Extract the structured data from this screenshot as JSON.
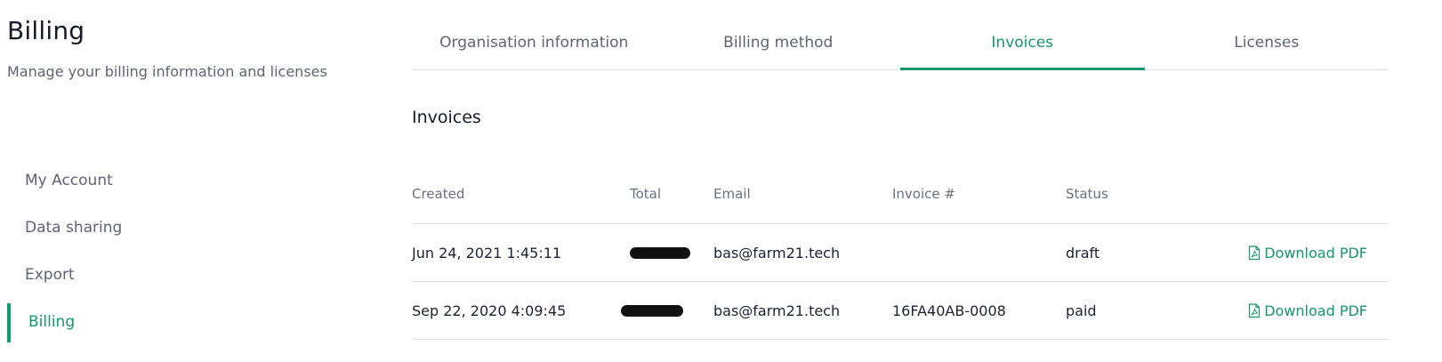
{
  "header": {
    "title": "Billing",
    "subtitle": "Manage your billing information and licenses"
  },
  "sidebar": {
    "items": [
      {
        "label": "My Account",
        "active": false
      },
      {
        "label": "Data sharing",
        "active": false
      },
      {
        "label": "Export",
        "active": false
      },
      {
        "label": "Billing",
        "active": true
      }
    ]
  },
  "tabs": [
    {
      "label": "Organisation information",
      "active": false
    },
    {
      "label": "Billing method",
      "active": false
    },
    {
      "label": "Invoices",
      "active": true
    },
    {
      "label": "Licenses",
      "active": false
    }
  ],
  "section": {
    "title": "Invoices"
  },
  "table": {
    "columns": [
      "Created",
      "Total",
      "Email",
      "Invoice #",
      "Status"
    ],
    "rows": [
      {
        "created": "Jun 24, 2021 1:45:11",
        "total": "",
        "email": "bas@farm21.tech",
        "invoice": "",
        "status": "draft",
        "action": "Download PDF"
      },
      {
        "created": "Sep 22, 2020 4:09:45",
        "total": "",
        "email": "bas@farm21.tech",
        "invoice": "16FA40AB-0008",
        "status": "paid",
        "action": "Download PDF"
      }
    ]
  },
  "icons": {
    "download": "pdf-file-icon"
  },
  "colors": {
    "accent": "#15966b",
    "text": "#1c2233",
    "muted": "#5e6475",
    "divider": "#dcdfe5"
  }
}
